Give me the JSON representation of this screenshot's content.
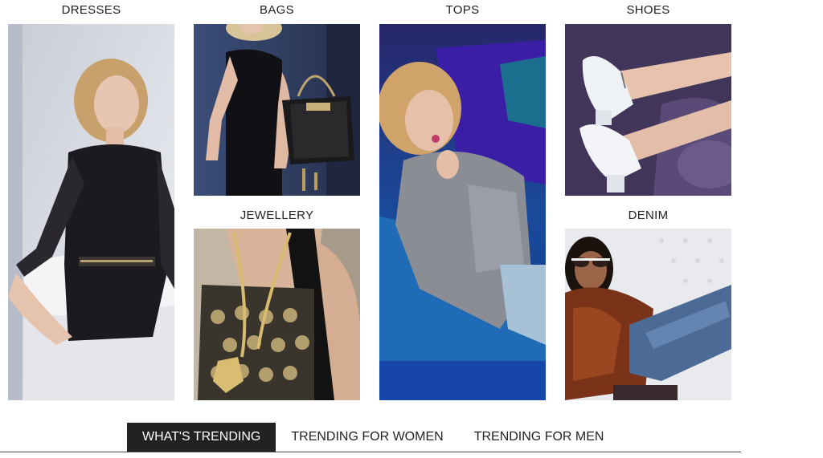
{
  "categories": {
    "dresses": "DRESSES",
    "bags": "BAGS",
    "tops": "TOPS",
    "shoes": "SHOES",
    "jewellery": "JEWELLERY",
    "denim": "DENIM"
  },
  "tabs": [
    {
      "label": "WHAT'S TRENDING",
      "active": true
    },
    {
      "label": "TRENDING FOR WOMEN",
      "active": false
    },
    {
      "label": "TRENDING FOR MEN",
      "active": false
    }
  ],
  "colors": {
    "active_tab_bg": "#222222",
    "text": "#222222"
  }
}
